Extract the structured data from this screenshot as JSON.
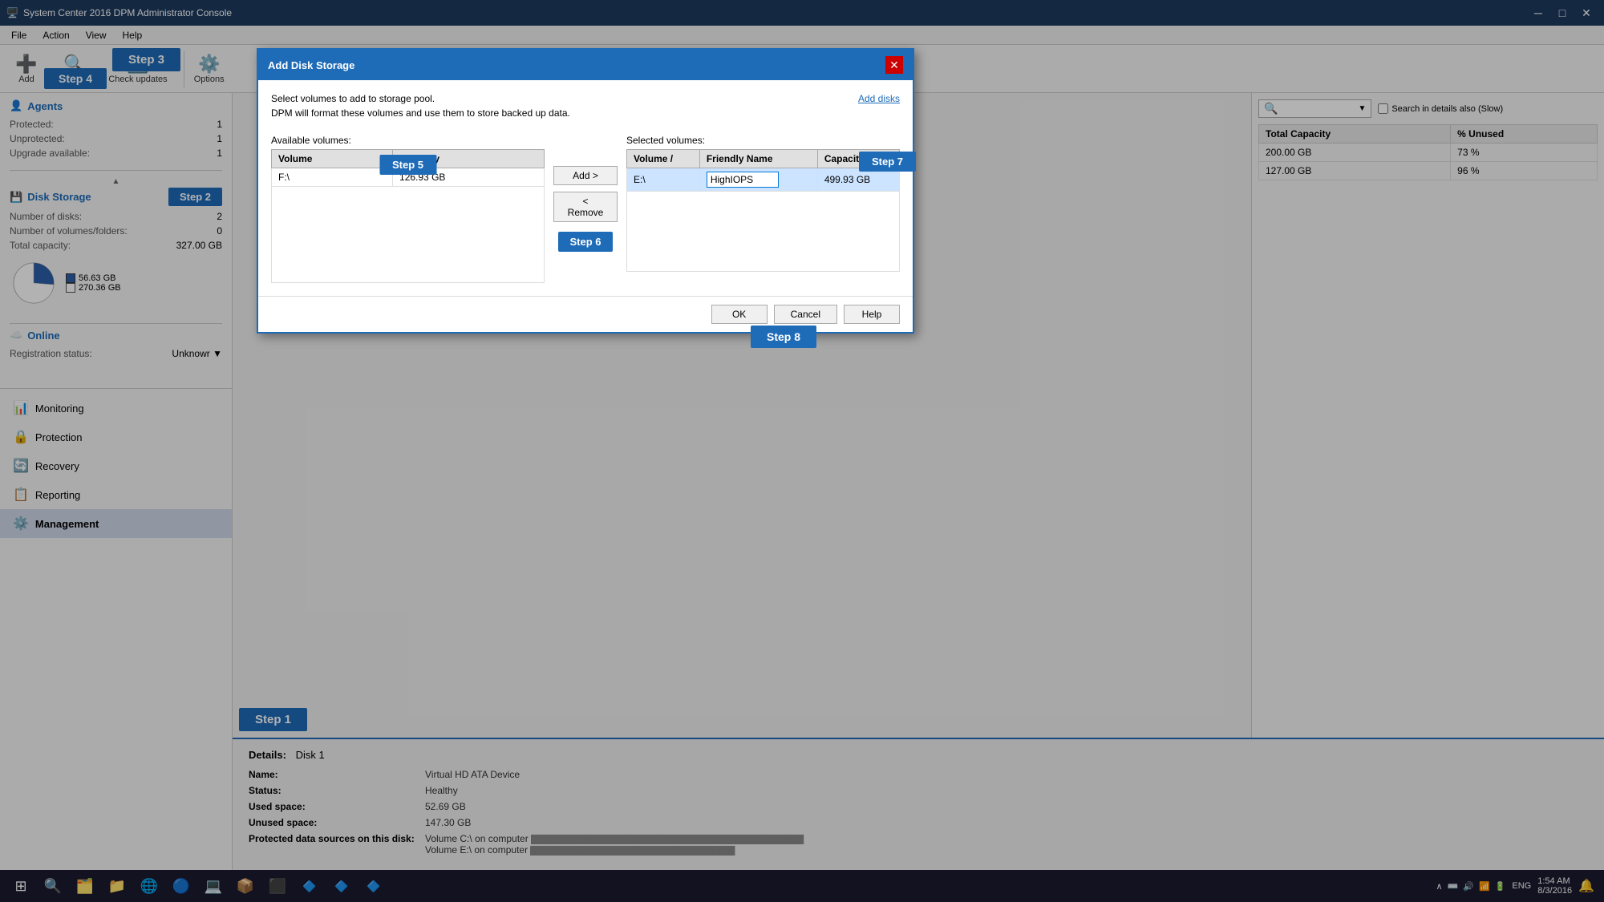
{
  "titleBar": {
    "title": "System Center 2016 DPM Administrator Console",
    "icon": "🖥️",
    "minBtn": "─",
    "maxBtn": "□",
    "closeBtn": "✕"
  },
  "menuBar": {
    "items": [
      "File",
      "Action",
      "View",
      "Help"
    ]
  },
  "toolbar": {
    "buttons": [
      {
        "label": "Add",
        "icon": "➕"
      },
      {
        "label": "Rescan",
        "icon": "🔍"
      },
      {
        "label": "Check updates",
        "icon": "🔄"
      },
      {
        "label": "Options",
        "icon": "⚙️"
      }
    ],
    "steps": {
      "step3": "Step 3",
      "step4": "Step 4"
    }
  },
  "sidebar": {
    "agentsTitle": "Agents",
    "protectedLabel": "Protected:",
    "protectedValue": "1",
    "unprotectedLabel": "Unprotected:",
    "unprotectedValue": "1",
    "upgradeLabel": "Upgrade available:",
    "upgradeValue": "1",
    "diskStorageTitle": "Disk Storage",
    "step2Label": "Step 2",
    "numDisksLabel": "Number of disks:",
    "numDisksValue": "2",
    "numVolumesLabel": "Number of volumes/folders:",
    "numVolumesValue": "0",
    "totalCapLabel": "Total capacity:",
    "totalCapValue": "327.00 GB",
    "legend": [
      {
        "color": "#2c5fa8",
        "label": "56.63 GB"
      },
      {
        "color": "white",
        "border": "#555",
        "label": "270.36 GB"
      }
    ],
    "onlineTitle": "Online",
    "registrationLabel": "Registration status:",
    "registrationValue": "Unknowr",
    "navItems": [
      {
        "icon": "📊",
        "label": "Monitoring"
      },
      {
        "icon": "🔒",
        "label": "Protection"
      },
      {
        "icon": "🔄",
        "label": "Recovery"
      },
      {
        "icon": "📋",
        "label": "Reporting"
      },
      {
        "icon": "⚙️",
        "label": "Management",
        "active": true
      }
    ]
  },
  "rightPanel": {
    "searchPlaceholder": "",
    "searchLabel": "Search in details also (Slow)",
    "columns": [
      "Total Capacity",
      "% Unused"
    ],
    "rows": [
      {
        "totalCap": "200.00 GB",
        "unused": "73 %"
      },
      {
        "totalCap": "127.00 GB",
        "unused": "96 %"
      }
    ]
  },
  "details": {
    "title": "Details:",
    "disk": "Disk 1",
    "fields": [
      {
        "label": "Name:",
        "value": "Virtual HD ATA Device"
      },
      {
        "label": "Status:",
        "value": "Healthy"
      },
      {
        "label": "Used space:",
        "value": "52.69 GB"
      },
      {
        "label": "Unused space:",
        "value": "147.30 GB"
      },
      {
        "label": "Protected data sources on this disk:",
        "value": "Volume C:\\ on computer ██████████████████████████████████████████████\nVolume E:\\ on computer ██████████████████████████████████"
      }
    ]
  },
  "step1Label": "Step 1",
  "modal": {
    "title": "Add Disk Storage",
    "closeBtn": "✕",
    "instruction1": "Select volumes to add to storage pool.",
    "instruction2": "DPM will format these volumes and use them to store backed up data.",
    "addDisksLink": "Add disks",
    "availableTitle": "Available volumes:",
    "selectedTitle": "Selected volumes:",
    "availableCols": [
      "Volume",
      "Capacity"
    ],
    "availableRows": [
      {
        "volume": "F:\\",
        "capacity": "126.93 GB"
      }
    ],
    "selectedCols": [
      "Volume /",
      "Friendly Name",
      "Capacity"
    ],
    "selectedRows": [
      {
        "volume": "E:\\",
        "friendlyName": "HighIOPS",
        "capacity": "499.93 GB"
      }
    ],
    "addBtn": "Add >",
    "removeBtn": "< Remove",
    "okBtn": "OK",
    "cancelBtn": "Cancel",
    "helpBtn": "Help",
    "steps": {
      "step5": "Step 5",
      "step6": "Step 6",
      "step7": "Step 7",
      "step8": "Step 8"
    }
  },
  "taskbar": {
    "icons": [
      "⊞",
      "🔍",
      "🗂️",
      "📁",
      "🌐",
      "💻",
      "📦",
      "⬛",
      "🔵",
      "🏷️",
      "🔵"
    ],
    "time": "1:54 AM",
    "date": "8/3/2016",
    "lang": "ENG"
  }
}
